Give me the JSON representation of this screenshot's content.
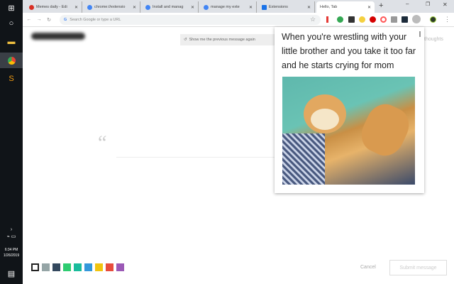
{
  "taskbar": {
    "time": "6:34 PM",
    "date": "1/26/2019"
  },
  "tabs": [
    {
      "label": "Memes daily - Edi",
      "icon_color": "#d93025"
    },
    {
      "label": "chrome://extensio",
      "icon_color": "#4285f4"
    },
    {
      "label": "Install and manag",
      "icon_color": "#4285f4"
    },
    {
      "label": "manage my exte",
      "icon_color": "#4285f4"
    },
    {
      "label": "Extensions",
      "icon_color": "#1a73e8"
    },
    {
      "label": "Hello, Tab",
      "icon_color": ""
    }
  ],
  "toolbar": {
    "omnibox_placeholder": "Search Google or type a URL"
  },
  "content": {
    "previous_message": "Show me the previous message again",
    "thoughts_hint": "thoughts",
    "quote_mark": "“",
    "cancel": "Cancel",
    "submit": "Submit message"
  },
  "swatches": [
    "#ffffff",
    "#95a5a6",
    "#34495e",
    "#2ecc71",
    "#1abc9c",
    "#3498db",
    "#f1c40f",
    "#e74c3c",
    "#9b59b6"
  ],
  "popup": {
    "caption": "When you're wrestling with your little brother and you take it too far and he starts crying for mom"
  }
}
